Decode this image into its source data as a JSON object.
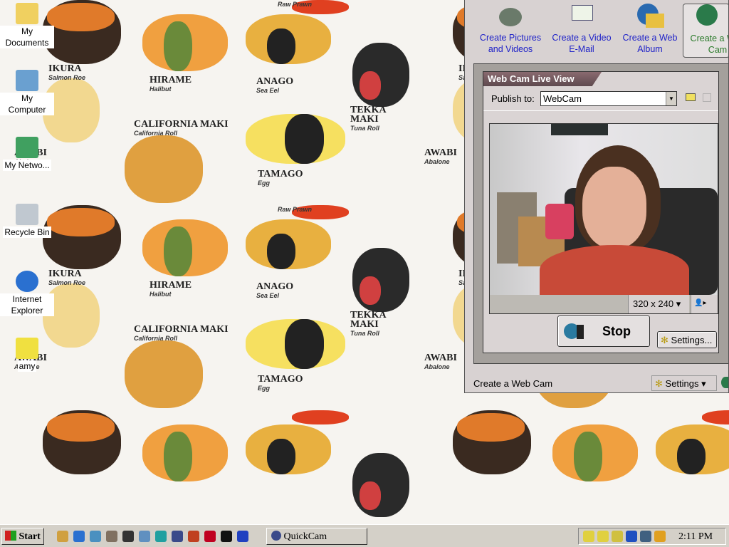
{
  "wallpaper": {
    "labels": [
      {
        "name": "IKURA",
        "sub": "Salmon Roe"
      },
      {
        "name": "HIRAME",
        "sub": "Halibut"
      },
      {
        "name": "ANAGO",
        "sub": "Sea Eel"
      },
      {
        "name": "CALIFORNIA MAKI",
        "sub": "California Roll"
      },
      {
        "name": "TAMAGO",
        "sub": "Egg"
      },
      {
        "name": "TEKKA MAKI",
        "sub": "Tuna Roll"
      },
      {
        "name": "AWABI",
        "sub": "Abalone"
      },
      {
        "name": "",
        "sub": "Raw Prawn"
      }
    ]
  },
  "desktop_icons": [
    {
      "label": "My Documents",
      "icon": "folder-icon"
    },
    {
      "label": "My Computer",
      "icon": "computer-icon"
    },
    {
      "label": "My Netwo...",
      "icon": "network-icon"
    },
    {
      "label": "Recycle Bin",
      "icon": "recycle-bin-icon"
    },
    {
      "label": "Internet Explorer",
      "icon": "ie-icon"
    },
    {
      "label": "amy",
      "icon": "shortcut-icon"
    }
  ],
  "quickcam": {
    "tools": [
      {
        "label": "Create Pictures and Videos"
      },
      {
        "label": "Create a Video E-Mail"
      },
      {
        "label": "Create a Web Album"
      },
      {
        "label": "Create a Web Cam"
      }
    ],
    "panel_title": "Web Cam Live View",
    "publish_label": "Publish to:",
    "publish_value": "WebCam",
    "resolution": "320 x 240",
    "stop_label": "Stop",
    "settings_btn": "Settings...",
    "status": "Create a Web Cam",
    "settings_menu": "Settings"
  },
  "taskbar": {
    "start": "Start",
    "task": "QuickCam",
    "clock": "2:11 PM"
  },
  "colors": {
    "accent_link": "#1f22c8",
    "active_tool": "#2a7a2a"
  }
}
